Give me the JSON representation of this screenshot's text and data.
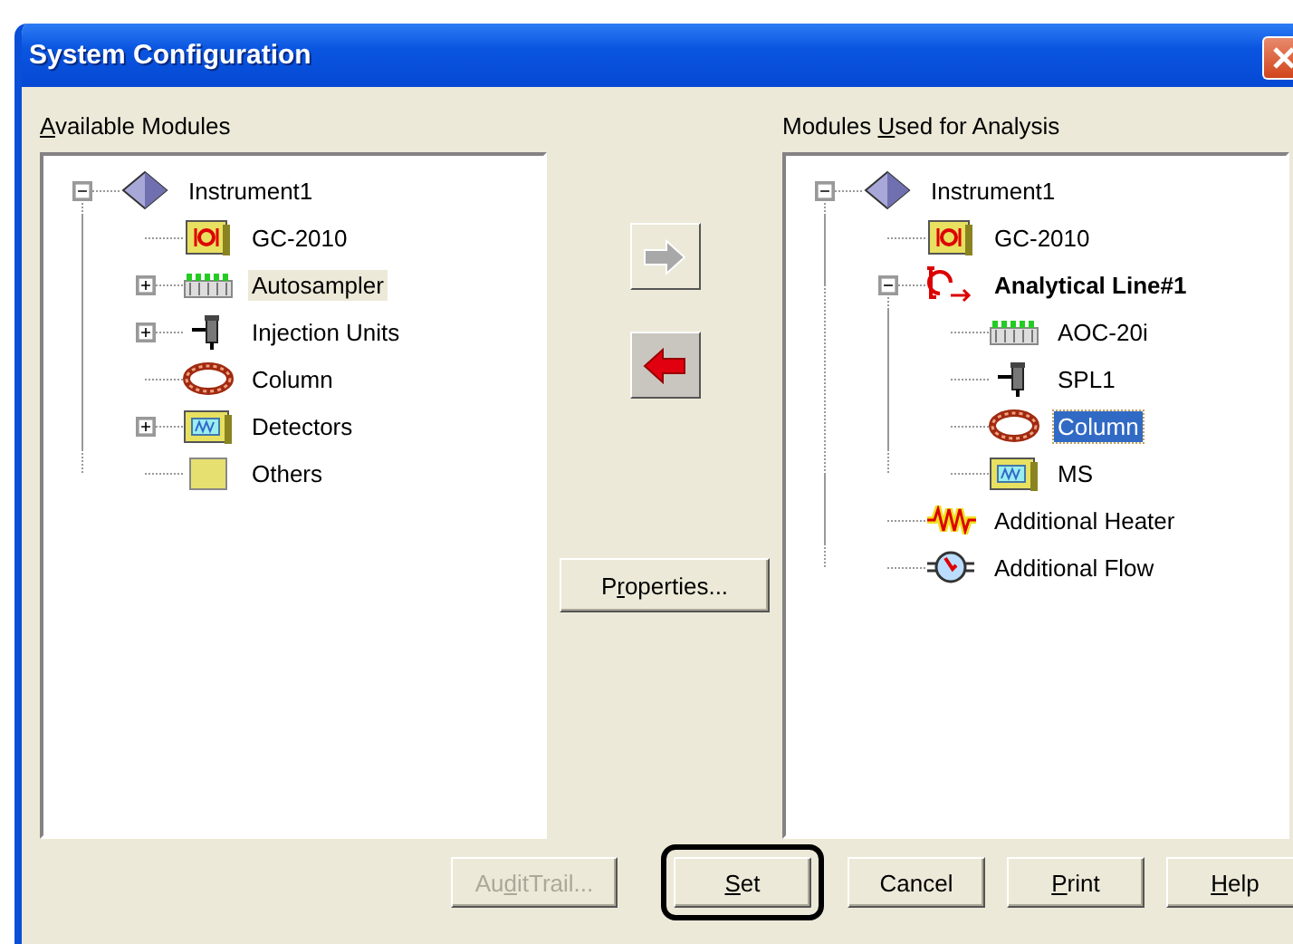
{
  "window": {
    "title": "System Configuration"
  },
  "available_modules": {
    "label": [
      {
        "text": "A",
        "underline": true
      },
      {
        "text": "vailable Modules",
        "underline": false
      }
    ],
    "focused": false,
    "tree": [
      {
        "label": "Instrument1",
        "kind": "instrument",
        "expanded": true,
        "selected": false,
        "children": [
          {
            "label": "GC-2010",
            "kind": "gc",
            "selected": false
          },
          {
            "label": "Autosampler",
            "kind": "autosampler",
            "expanded": false,
            "selected": true
          },
          {
            "label": "Injection Units",
            "kind": "injector",
            "expanded": false,
            "selected": false
          },
          {
            "label": "Column",
            "kind": "column",
            "selected": false
          },
          {
            "label": "Detectors",
            "kind": "detector",
            "expanded": false,
            "selected": false
          },
          {
            "label": "Others",
            "kind": "others",
            "selected": false
          }
        ]
      }
    ]
  },
  "move_buttons": [
    {
      "kind": "right",
      "disabled": true
    },
    {
      "kind": "left",
      "disabled": false
    }
  ],
  "properties_button": {
    "label": [
      {
        "text": "P",
        "underline": false
      },
      {
        "text": "r",
        "underline": true
      },
      {
        "text": "operties...",
        "underline": false
      }
    ],
    "disabled": false
  },
  "modules_used": {
    "label": [
      {
        "text": "Modules ",
        "underline": false
      },
      {
        "text": "U",
        "underline": true
      },
      {
        "text": "sed for Analysis",
        "underline": false
      }
    ],
    "focused": true,
    "tree": [
      {
        "label": "Instrument1",
        "kind": "instrument",
        "expanded": true,
        "selected": false,
        "children": [
          {
            "label": "GC-2010",
            "kind": "gc",
            "selected": false
          },
          {
            "label": "Analytical Line#1",
            "kind": "line",
            "expanded": true,
            "selected": false,
            "children": [
              {
                "label": "AOC-20i",
                "kind": "autosampler",
                "selected": false
              },
              {
                "label": "SPL1",
                "kind": "injector",
                "selected": false
              },
              {
                "label": "Column",
                "kind": "column",
                "selected": true
              },
              {
                "label": "MS",
                "kind": "detector",
                "selected": false
              }
            ]
          },
          {
            "label": "Additional Heater",
            "kind": "heater",
            "selected": false
          },
          {
            "label": "Additional Flow",
            "kind": "flow",
            "selected": false
          }
        ]
      }
    ]
  },
  "buttons": [
    {
      "label": [
        {
          "text": "Au",
          "underline": false
        },
        {
          "text": "d",
          "underline": true
        },
        {
          "text": "itTrail...",
          "underline": false
        }
      ],
      "disabled": true,
      "default": false
    },
    {
      "label": [
        {
          "text": "S",
          "underline": true
        },
        {
          "text": "et",
          "underline": false
        }
      ],
      "disabled": false,
      "default": true
    },
    {
      "label": [
        {
          "text": "Cancel",
          "underline": false
        }
      ],
      "disabled": false,
      "default": false
    },
    {
      "label": [
        {
          "text": "P",
          "underline": true
        },
        {
          "text": "rint",
          "underline": false
        }
      ],
      "disabled": false,
      "default": false
    },
    {
      "label": [
        {
          "text": "H",
          "underline": true
        },
        {
          "text": "elp",
          "underline": false
        }
      ],
      "disabled": false,
      "default": false
    }
  ]
}
